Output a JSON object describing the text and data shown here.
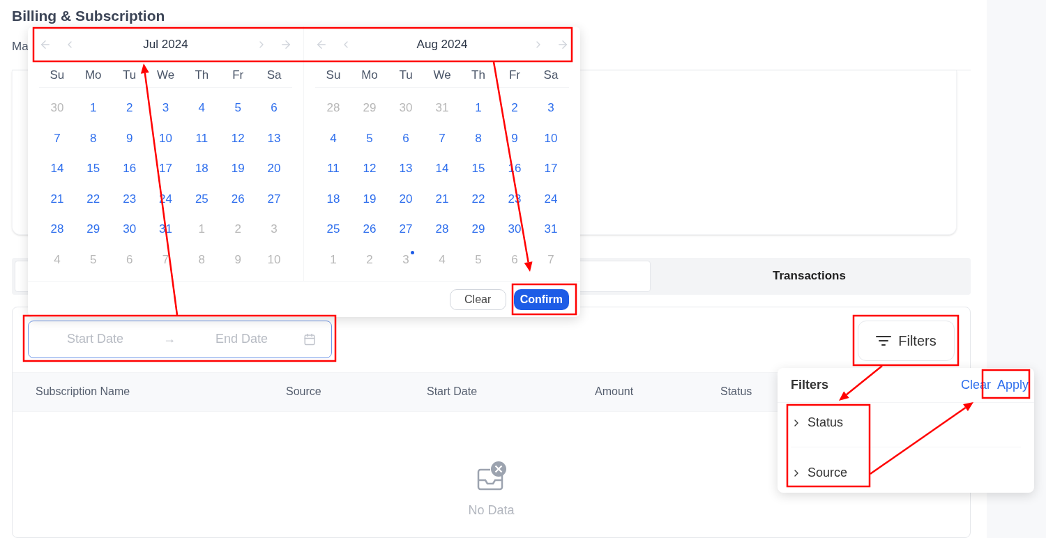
{
  "page": {
    "title": "Billing & Subscription",
    "subtitle": "Ma"
  },
  "tabs": [
    {
      "selected": true
    },
    {
      "label": "Transactions",
      "selected": false
    }
  ],
  "date_range": {
    "start_placeholder": "Start Date",
    "separator": "→",
    "end_placeholder": "End Date"
  },
  "filters_button": {
    "label": "Filters"
  },
  "table": {
    "columns": [
      "Subscription Name",
      "Source",
      "Start Date",
      "Amount",
      "Status"
    ],
    "empty_text": "No Data"
  },
  "date_picker": {
    "months": [
      {
        "title": "Jul 2024",
        "weekdays": [
          "Su",
          "Mo",
          "Tu",
          "We",
          "Th",
          "Fr",
          "Sa"
        ],
        "weeks": [
          [
            {
              "day": "30",
              "in_month": false,
              "today": false
            },
            {
              "day": "1",
              "in_month": true,
              "today": false
            },
            {
              "day": "2",
              "in_month": true,
              "today": false
            },
            {
              "day": "3",
              "in_month": true,
              "today": false
            },
            {
              "day": "4",
              "in_month": true,
              "today": false
            },
            {
              "day": "5",
              "in_month": true,
              "today": false
            },
            {
              "day": "6",
              "in_month": true,
              "today": false
            }
          ],
          [
            {
              "day": "7",
              "in_month": true,
              "today": false
            },
            {
              "day": "8",
              "in_month": true,
              "today": false
            },
            {
              "day": "9",
              "in_month": true,
              "today": false
            },
            {
              "day": "10",
              "in_month": true,
              "today": false
            },
            {
              "day": "11",
              "in_month": true,
              "today": false
            },
            {
              "day": "12",
              "in_month": true,
              "today": false
            },
            {
              "day": "13",
              "in_month": true,
              "today": false
            }
          ],
          [
            {
              "day": "14",
              "in_month": true,
              "today": false
            },
            {
              "day": "15",
              "in_month": true,
              "today": false
            },
            {
              "day": "16",
              "in_month": true,
              "today": false
            },
            {
              "day": "17",
              "in_month": true,
              "today": false
            },
            {
              "day": "18",
              "in_month": true,
              "today": false
            },
            {
              "day": "19",
              "in_month": true,
              "today": false
            },
            {
              "day": "20",
              "in_month": true,
              "today": false
            }
          ],
          [
            {
              "day": "21",
              "in_month": true,
              "today": false
            },
            {
              "day": "22",
              "in_month": true,
              "today": false
            },
            {
              "day": "23",
              "in_month": true,
              "today": false
            },
            {
              "day": "24",
              "in_month": true,
              "today": false
            },
            {
              "day": "25",
              "in_month": true,
              "today": false
            },
            {
              "day": "26",
              "in_month": true,
              "today": false
            },
            {
              "day": "27",
              "in_month": true,
              "today": false
            }
          ],
          [
            {
              "day": "28",
              "in_month": true,
              "today": false
            },
            {
              "day": "29",
              "in_month": true,
              "today": false
            },
            {
              "day": "30",
              "in_month": true,
              "today": false
            },
            {
              "day": "31",
              "in_month": true,
              "today": false
            },
            {
              "day": "1",
              "in_month": false,
              "today": false
            },
            {
              "day": "2",
              "in_month": false,
              "today": false
            },
            {
              "day": "3",
              "in_month": false,
              "today": false
            }
          ],
          [
            {
              "day": "4",
              "in_month": false,
              "today": false
            },
            {
              "day": "5",
              "in_month": false,
              "today": false
            },
            {
              "day": "6",
              "in_month": false,
              "today": false
            },
            {
              "day": "7",
              "in_month": false,
              "today": false
            },
            {
              "day": "8",
              "in_month": false,
              "today": false
            },
            {
              "day": "9",
              "in_month": false,
              "today": false
            },
            {
              "day": "10",
              "in_month": false,
              "today": false
            }
          ]
        ]
      },
      {
        "title": "Aug 2024",
        "weekdays": [
          "Su",
          "Mo",
          "Tu",
          "We",
          "Th",
          "Fr",
          "Sa"
        ],
        "weeks": [
          [
            {
              "day": "28",
              "in_month": false,
              "today": false
            },
            {
              "day": "29",
              "in_month": false,
              "today": false
            },
            {
              "day": "30",
              "in_month": false,
              "today": false
            },
            {
              "day": "31",
              "in_month": false,
              "today": false
            },
            {
              "day": "1",
              "in_month": true,
              "today": false
            },
            {
              "day": "2",
              "in_month": true,
              "today": false
            },
            {
              "day": "3",
              "in_month": true,
              "today": false
            }
          ],
          [
            {
              "day": "4",
              "in_month": true,
              "today": false
            },
            {
              "day": "5",
              "in_month": true,
              "today": false
            },
            {
              "day": "6",
              "in_month": true,
              "today": false
            },
            {
              "day": "7",
              "in_month": true,
              "today": false
            },
            {
              "day": "8",
              "in_month": true,
              "today": false
            },
            {
              "day": "9",
              "in_month": true,
              "today": false
            },
            {
              "day": "10",
              "in_month": true,
              "today": false
            }
          ],
          [
            {
              "day": "11",
              "in_month": true,
              "today": false
            },
            {
              "day": "12",
              "in_month": true,
              "today": false
            },
            {
              "day": "13",
              "in_month": true,
              "today": false
            },
            {
              "day": "14",
              "in_month": true,
              "today": false
            },
            {
              "day": "15",
              "in_month": true,
              "today": false
            },
            {
              "day": "16",
              "in_month": true,
              "today": false
            },
            {
              "day": "17",
              "in_month": true,
              "today": false
            }
          ],
          [
            {
              "day": "18",
              "in_month": true,
              "today": false
            },
            {
              "day": "19",
              "in_month": true,
              "today": false
            },
            {
              "day": "20",
              "in_month": true,
              "today": false
            },
            {
              "day": "21",
              "in_month": true,
              "today": false
            },
            {
              "day": "22",
              "in_month": true,
              "today": false
            },
            {
              "day": "23",
              "in_month": true,
              "today": false
            },
            {
              "day": "24",
              "in_month": true,
              "today": false
            }
          ],
          [
            {
              "day": "25",
              "in_month": true,
              "today": false
            },
            {
              "day": "26",
              "in_month": true,
              "today": false
            },
            {
              "day": "27",
              "in_month": true,
              "today": false
            },
            {
              "day": "28",
              "in_month": true,
              "today": false
            },
            {
              "day": "29",
              "in_month": true,
              "today": false
            },
            {
              "day": "30",
              "in_month": true,
              "today": false
            },
            {
              "day": "31",
              "in_month": true,
              "today": false
            }
          ],
          [
            {
              "day": "1",
              "in_month": false,
              "today": false
            },
            {
              "day": "2",
              "in_month": false,
              "today": false
            },
            {
              "day": "3",
              "in_month": false,
              "today": true
            },
            {
              "day": "4",
              "in_month": false,
              "today": false
            },
            {
              "day": "5",
              "in_month": false,
              "today": false
            },
            {
              "day": "6",
              "in_month": false,
              "today": false
            },
            {
              "day": "7",
              "in_month": false,
              "today": false
            }
          ]
        ]
      }
    ],
    "buttons": [
      {
        "label": "Clear",
        "kind": "secondary"
      },
      {
        "label": "Confirm",
        "kind": "primary"
      }
    ]
  },
  "filter_menu": {
    "title": "Filters",
    "clear": "Clear",
    "apply": "Apply",
    "items": [
      {
        "label": "Status",
        "expanded": false
      },
      {
        "label": "Source",
        "expanded": false
      }
    ]
  }
}
